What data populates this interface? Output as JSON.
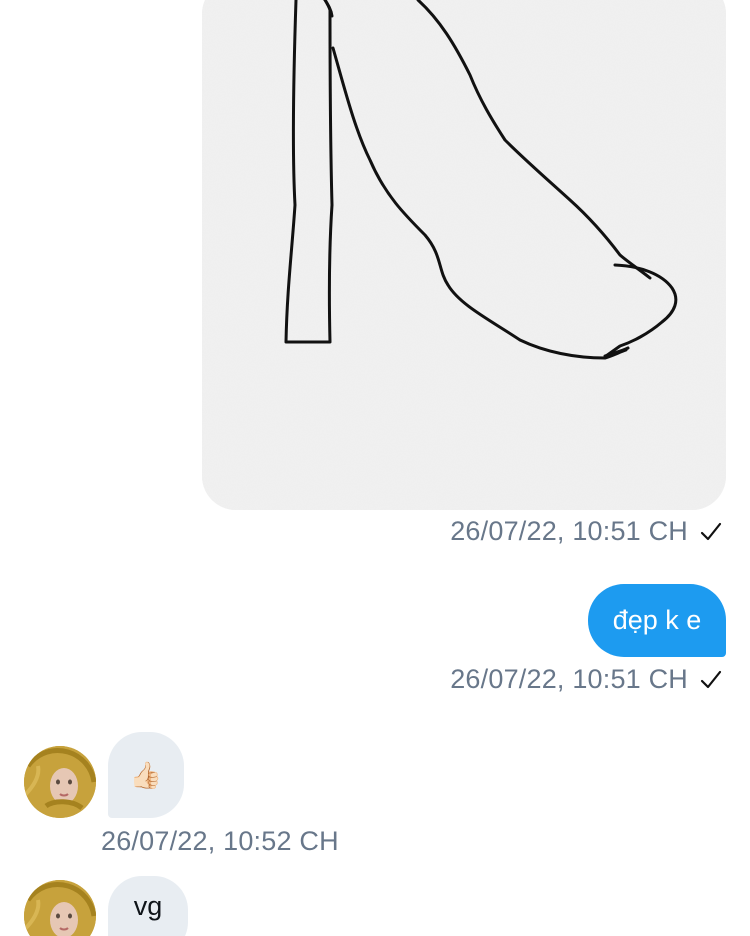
{
  "messages": {
    "image_message": {
      "timestamp": "26/07/22, 10:51 CH",
      "status_icon": "check-icon"
    },
    "sent_text": {
      "text": "đẹp k e",
      "timestamp": "26/07/22, 10:51 CH",
      "status_icon": "check-icon"
    },
    "received_emoji": {
      "emoji": "👍🏻",
      "timestamp": "26/07/22, 10:52 CH"
    },
    "received_text": {
      "text": "vg"
    }
  },
  "colors": {
    "sent_bubble": "#1d9bf0",
    "received_bubble": "#e8edf2",
    "timestamp": "#68778a",
    "image_background": "#f1f1f1"
  }
}
